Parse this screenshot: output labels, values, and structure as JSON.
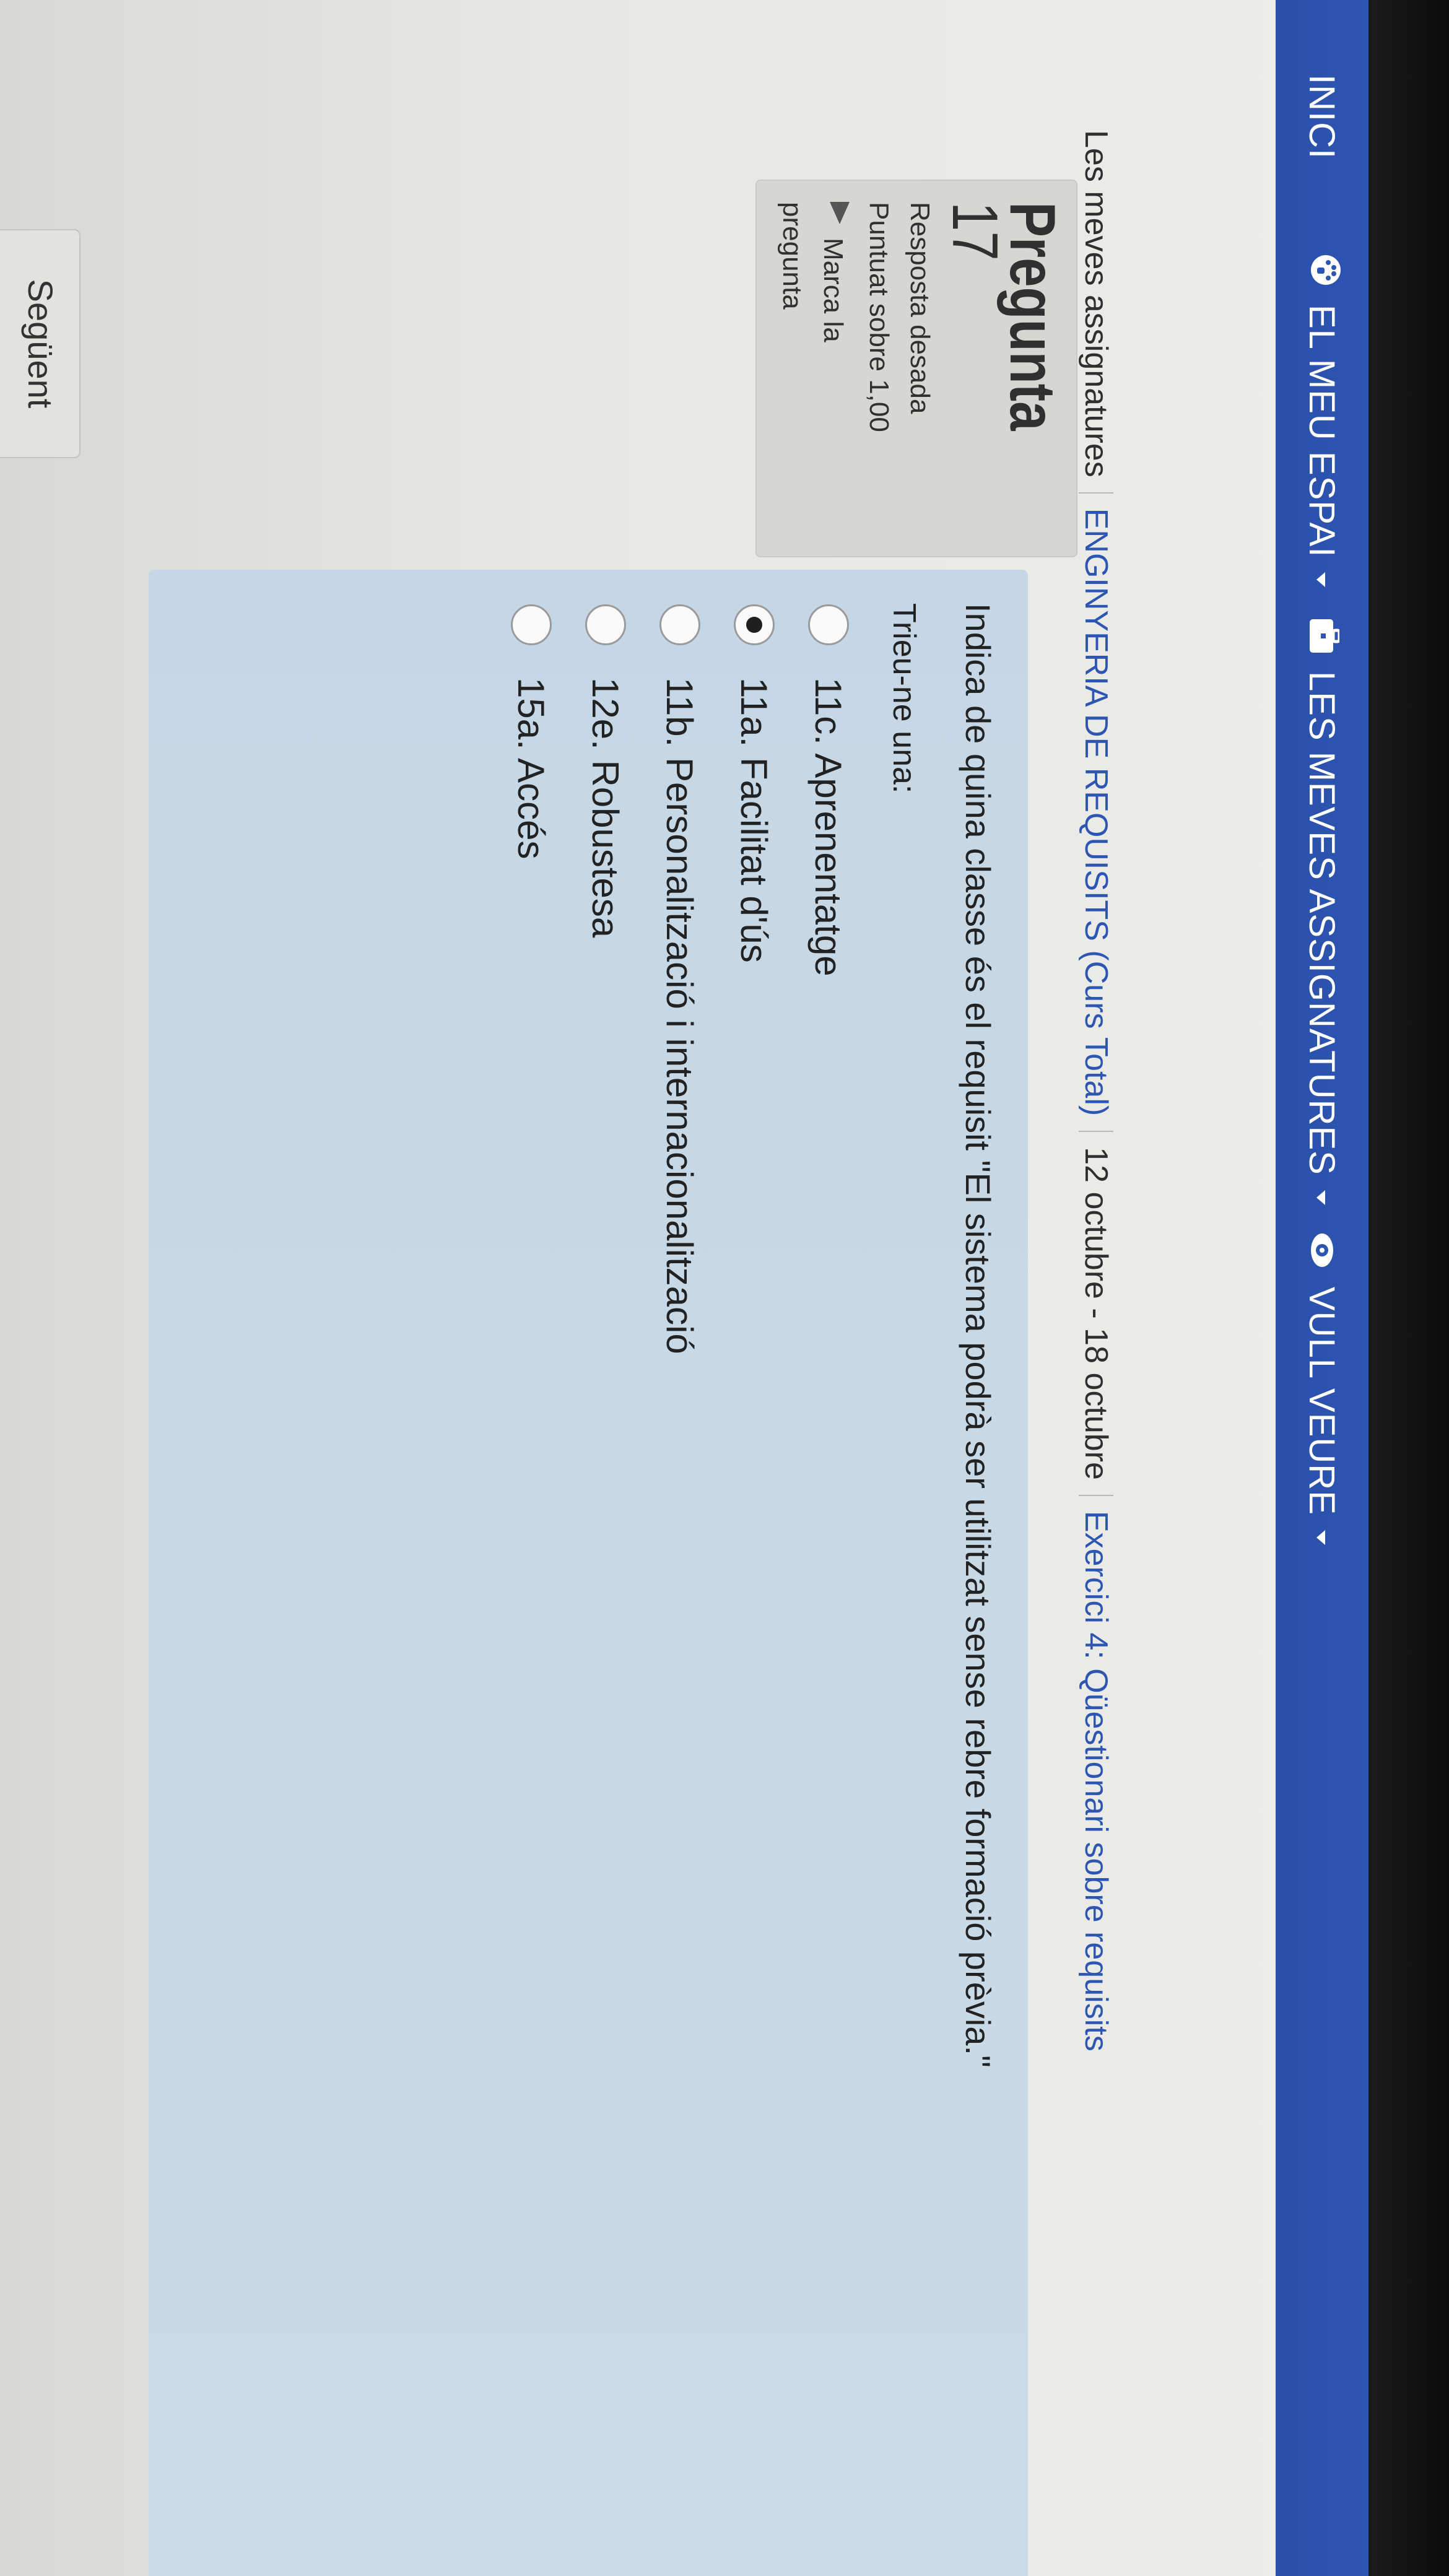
{
  "navbar": {
    "items": [
      {
        "label": "INICI",
        "icon": ""
      },
      {
        "label": "EL MEU ESPAI",
        "icon": "dashboard-icon",
        "dropdown": true
      },
      {
        "label": "LES MEVES ASSIGNATURES",
        "icon": "briefcase-icon",
        "dropdown": true
      },
      {
        "label": "VULL VEURE",
        "icon": "eye-icon",
        "dropdown": true
      }
    ],
    "background": "#2d55b2"
  },
  "breadcrumb": {
    "items": [
      "Les meves assignatures",
      "ENGINYERIA DE REQUISITS (Curs Total)",
      "12 octubre - 18 octubre",
      "Exercici 4: Qüestionari sobre requisits"
    ]
  },
  "question_info": {
    "label": "Pregunta",
    "number": "17",
    "status": "Resposta desada",
    "score": "Puntuat sobre 1,00",
    "flag_label_line1": "Marca la",
    "flag_label_line2": "pregunta",
    "flag_icon": "flag-icon"
  },
  "question": {
    "text": "Indica de quina classe és el requisit \"El sistema podrà ser utilitzat sense rebre formació prèvia.\"",
    "prompt": "Trieu-ne una:",
    "options": [
      {
        "label": "11c. Aprenentatge",
        "selected": false
      },
      {
        "label": "11a. Facilitat d'ús",
        "selected": true
      },
      {
        "label": "11b. Personalització i internacionalització",
        "selected": false
      },
      {
        "label": "12e. Robustesa",
        "selected": false
      },
      {
        "label": "15a. Accés",
        "selected": false
      }
    ]
  },
  "navigation": {
    "next_label": "Següent"
  }
}
